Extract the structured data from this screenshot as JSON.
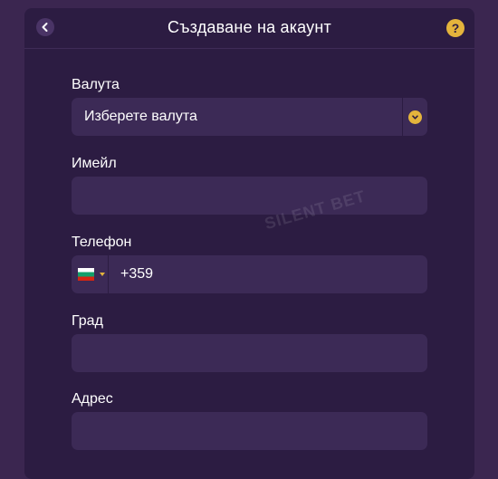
{
  "header": {
    "title": "Създаване на акаунт",
    "back_icon": "chevron-left-icon",
    "help_label": "?"
  },
  "fields": {
    "currency": {
      "label": "Валута",
      "value": "Изберете валута",
      "icon": "chevron-down-icon"
    },
    "email": {
      "label": "Имейл",
      "value": ""
    },
    "phone": {
      "label": "Телефон",
      "country_flag": "bulgaria-flag-icon",
      "value": "+359"
    },
    "city": {
      "label": "Град",
      "value": ""
    },
    "address": {
      "label": "Адрес",
      "value": ""
    }
  },
  "watermark": {
    "text": "SILENT BET"
  },
  "colors": {
    "background": "#3b2650",
    "panel": "#2c1c42",
    "field": "#3c2a56",
    "accent": "#e4b43c"
  }
}
